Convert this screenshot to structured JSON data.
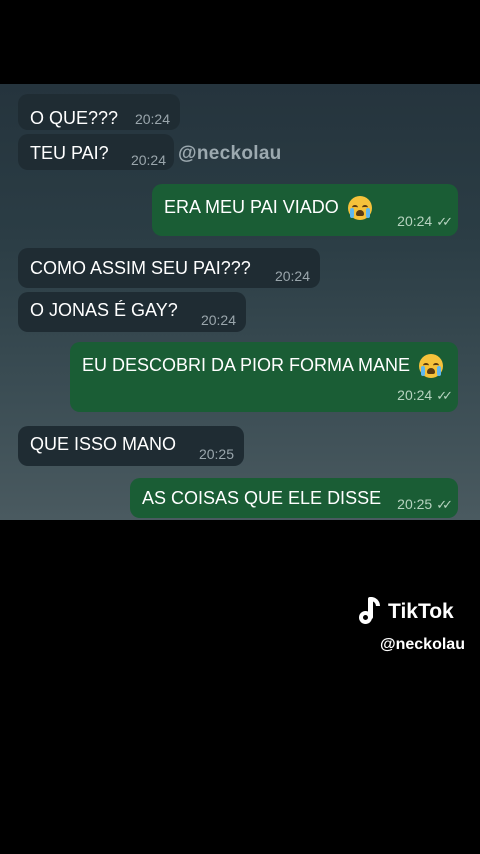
{
  "watermark": "@neckolau",
  "messages": [
    {
      "text": "O QUE???",
      "time": "20:24",
      "direction": "in"
    },
    {
      "text": "TEU PAI?",
      "time": "20:24",
      "direction": "in"
    },
    {
      "text": "ERA MEU PAI VIADO",
      "time": "20:24",
      "direction": "out",
      "emoji": "loudly-crying-face",
      "read": true
    },
    {
      "text": "COMO ASSIM SEU PAI???",
      "time": "20:24",
      "direction": "in"
    },
    {
      "text": "O JONAS É GAY?",
      "time": "20:24",
      "direction": "in"
    },
    {
      "text": "EU DESCOBRI DA PIOR FORMA MANE",
      "time": "20:24",
      "direction": "out",
      "emoji": "loudly-crying-face",
      "read": true
    },
    {
      "text": "QUE ISSO MANO",
      "time": "20:25",
      "direction": "in"
    },
    {
      "text": "AS COISAS QUE ELE DISSE",
      "time": "20:25",
      "direction": "out",
      "read": true
    }
  ],
  "tiktok": {
    "brand": "TikTok",
    "handle": "@neckolau"
  },
  "colors": {
    "incoming_bubble": "#1f2c33",
    "outgoing_bubble": "#1a5d35",
    "background": "#000000"
  }
}
